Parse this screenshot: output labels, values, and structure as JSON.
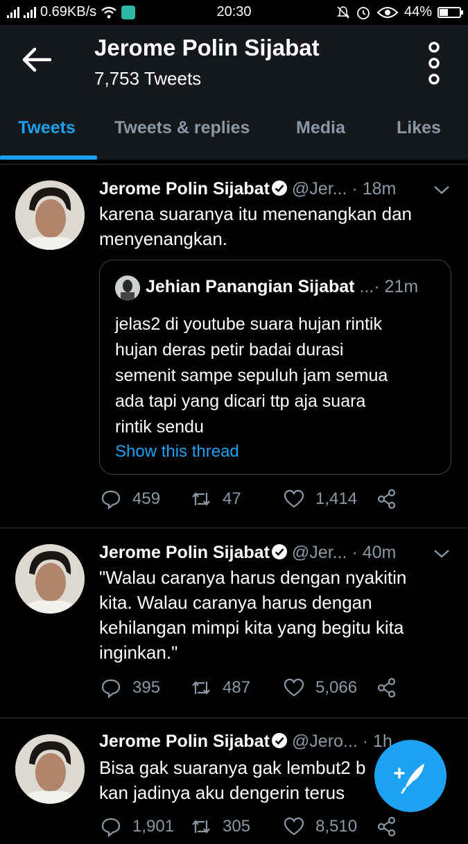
{
  "status_bar": {
    "network_speed": "0.69KB/s",
    "time": "20:30",
    "battery": "44%",
    "battery_level": 0.44
  },
  "header": {
    "title": "Jerome Polin Sijabat",
    "subtitle": "7,753 Tweets",
    "back_icon": "arrow-left-icon",
    "menu_icon": "more-vertical-icon"
  },
  "tabs": [
    {
      "label": "Tweets",
      "active": true
    },
    {
      "label": "Tweets & replies",
      "active": false
    },
    {
      "label": "Media",
      "active": false
    },
    {
      "label": "Likes",
      "active": false
    }
  ],
  "tweets": [
    {
      "name": "Jerome Polin Sijabat",
      "handle": "@Jer...",
      "time": "· 18m",
      "text_lines": [
        "karena suaranya itu menenangkan dan",
        "menyenangkan."
      ],
      "quote": {
        "name": "Jehian Panangian Sijabat",
        "handle": "...",
        "time": "· 21m",
        "text_lines": [
          "jelas2 di youtube suara hujan rintik",
          "hujan deras petir badai durasi",
          "semenit sampe sepuluh jam semua",
          "ada tapi yang dicari ttp aja suara",
          "rintik sendu"
        ],
        "link": "Show this thread"
      },
      "replies": "459",
      "retweets": "47",
      "likes": "1,414"
    },
    {
      "name": "Jerome Polin Sijabat",
      "handle": "@Jer...",
      "time": "· 40m",
      "text_lines": [
        "\"Walau caranya harus dengan nyakitin",
        "kita. Walau caranya harus dengan",
        "kehilangan mimpi kita yang begitu kita",
        "inginkan.\""
      ],
      "replies": "395",
      "retweets": "487",
      "likes": "5,066"
    },
    {
      "name": "Jerome Polin Sijabat",
      "handle": "@Jero...",
      "time": "· 1h",
      "text_lines": [
        "Bisa gak suaranya gak lembut2 b",
        "kan jadinya aku dengerin terus"
      ],
      "replies": "1,901",
      "retweets": "305",
      "likes": "8,510"
    }
  ],
  "fab": {
    "icon": "compose-tweet-icon"
  },
  "colors": {
    "accent": "#1da1f2",
    "background": "#000000",
    "header_bg": "#15181c",
    "muted": "#8b98a5"
  }
}
